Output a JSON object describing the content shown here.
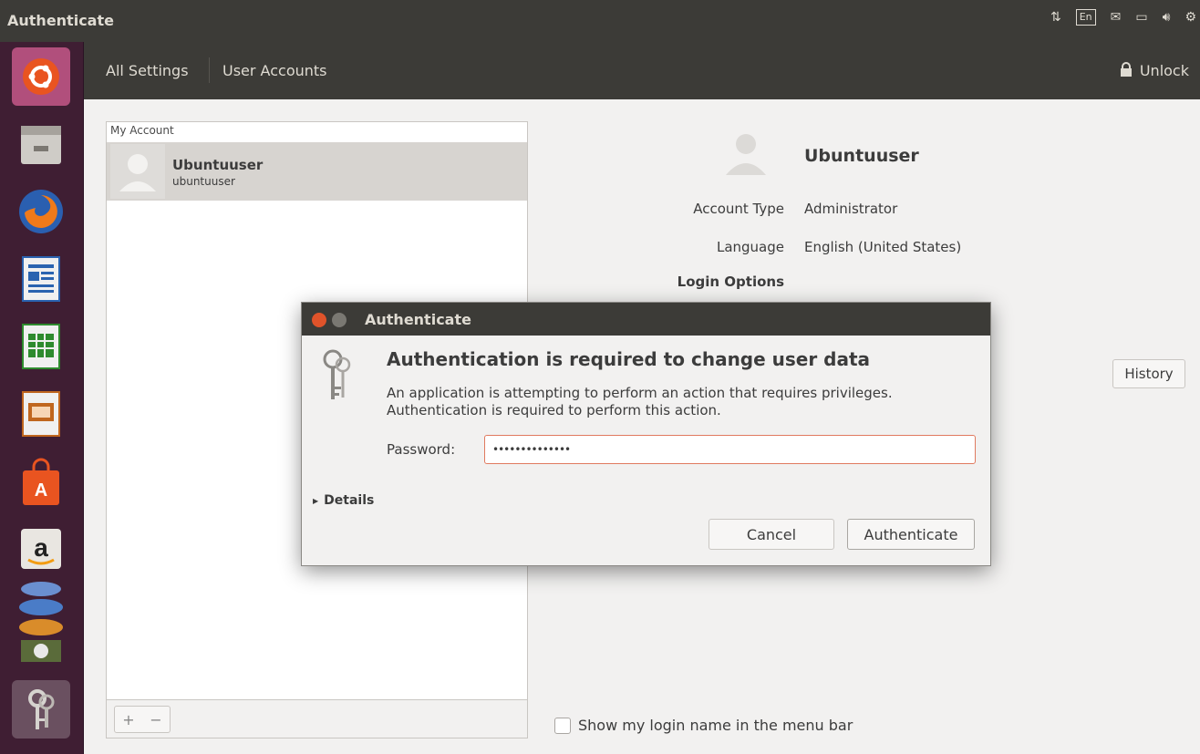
{
  "top_panel": {
    "title": "Authenticate",
    "keyboard_layout": "En",
    "icons": [
      "network-arrows-icon",
      "keyboard-layout-icon",
      "mail-icon",
      "battery-icon",
      "volume-icon",
      "gear-icon"
    ]
  },
  "launcher": {
    "items": [
      "ubuntu-dash-icon",
      "files-icon",
      "firefox-icon",
      "writer-icon",
      "calc-icon",
      "impress-icon",
      "software-center-icon",
      "amazon-icon",
      "stacked-apps-icon",
      "keys-icon"
    ]
  },
  "header": {
    "crumbs": [
      "All Settings",
      "User Accounts"
    ],
    "unlock_label": "Unlock"
  },
  "accounts": {
    "section_label": "My Account",
    "selected": {
      "name": "Ubuntuuser",
      "login": "ubuntuuser"
    },
    "add_label": "+",
    "remove_label": "−"
  },
  "details": {
    "name": "Ubuntuuser",
    "account_type_label": "Account Type",
    "account_type_value": "Administrator",
    "language_label": "Language",
    "language_value": "English (United States)",
    "login_options_label": "Login Options",
    "history_label": "History",
    "show_login_label": "Show my login name in the menu bar"
  },
  "dialog": {
    "title": "Authenticate",
    "heading": "Authentication is required to change user data",
    "body": "An application is attempting to perform an action that requires privileges. Authentication is required to perform this action.",
    "password_label": "Password:",
    "password_value": "••••••••••••••",
    "details_label": "Details",
    "cancel_label": "Cancel",
    "auth_label": "Authenticate"
  },
  "colors": {
    "panel": "#3c3b37",
    "launcher": "#3f1e33",
    "accent": "#e0532a"
  }
}
